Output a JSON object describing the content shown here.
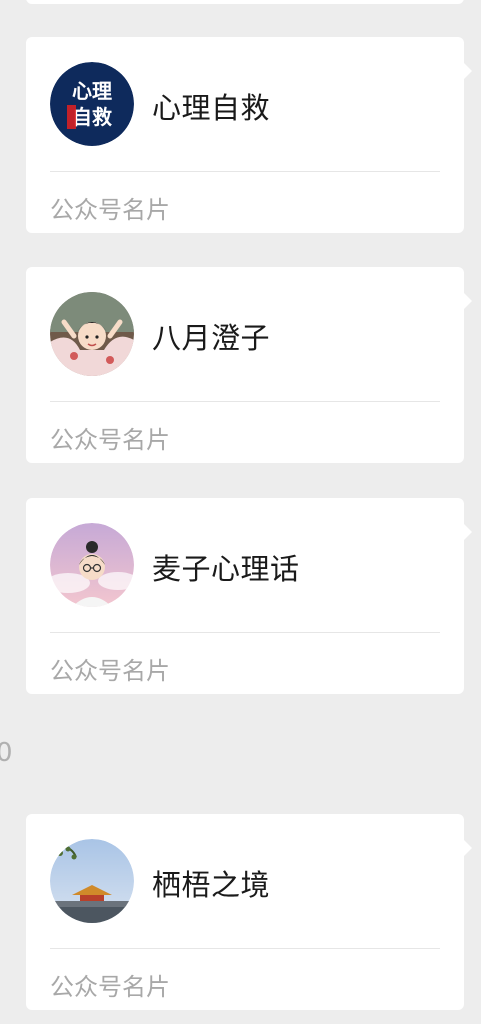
{
  "cards": [
    {
      "title": "心理自救",
      "footer": "公众号名片",
      "avatar_text_top": "心理",
      "avatar_text_bottom": "自救"
    },
    {
      "title": "八月澄子",
      "footer": "公众号名片"
    },
    {
      "title": "麦子心理话",
      "footer": "公众号名片"
    },
    {
      "title": "栖梧之境",
      "footer": "公众号名片"
    }
  ],
  "stray_text": "0",
  "colors": {
    "background": "#ededed",
    "card": "#ffffff",
    "footer_text": "#a8a8a8",
    "avatar1_bg": "#0e2a5c",
    "avatar1_accent": "#e02020"
  }
}
